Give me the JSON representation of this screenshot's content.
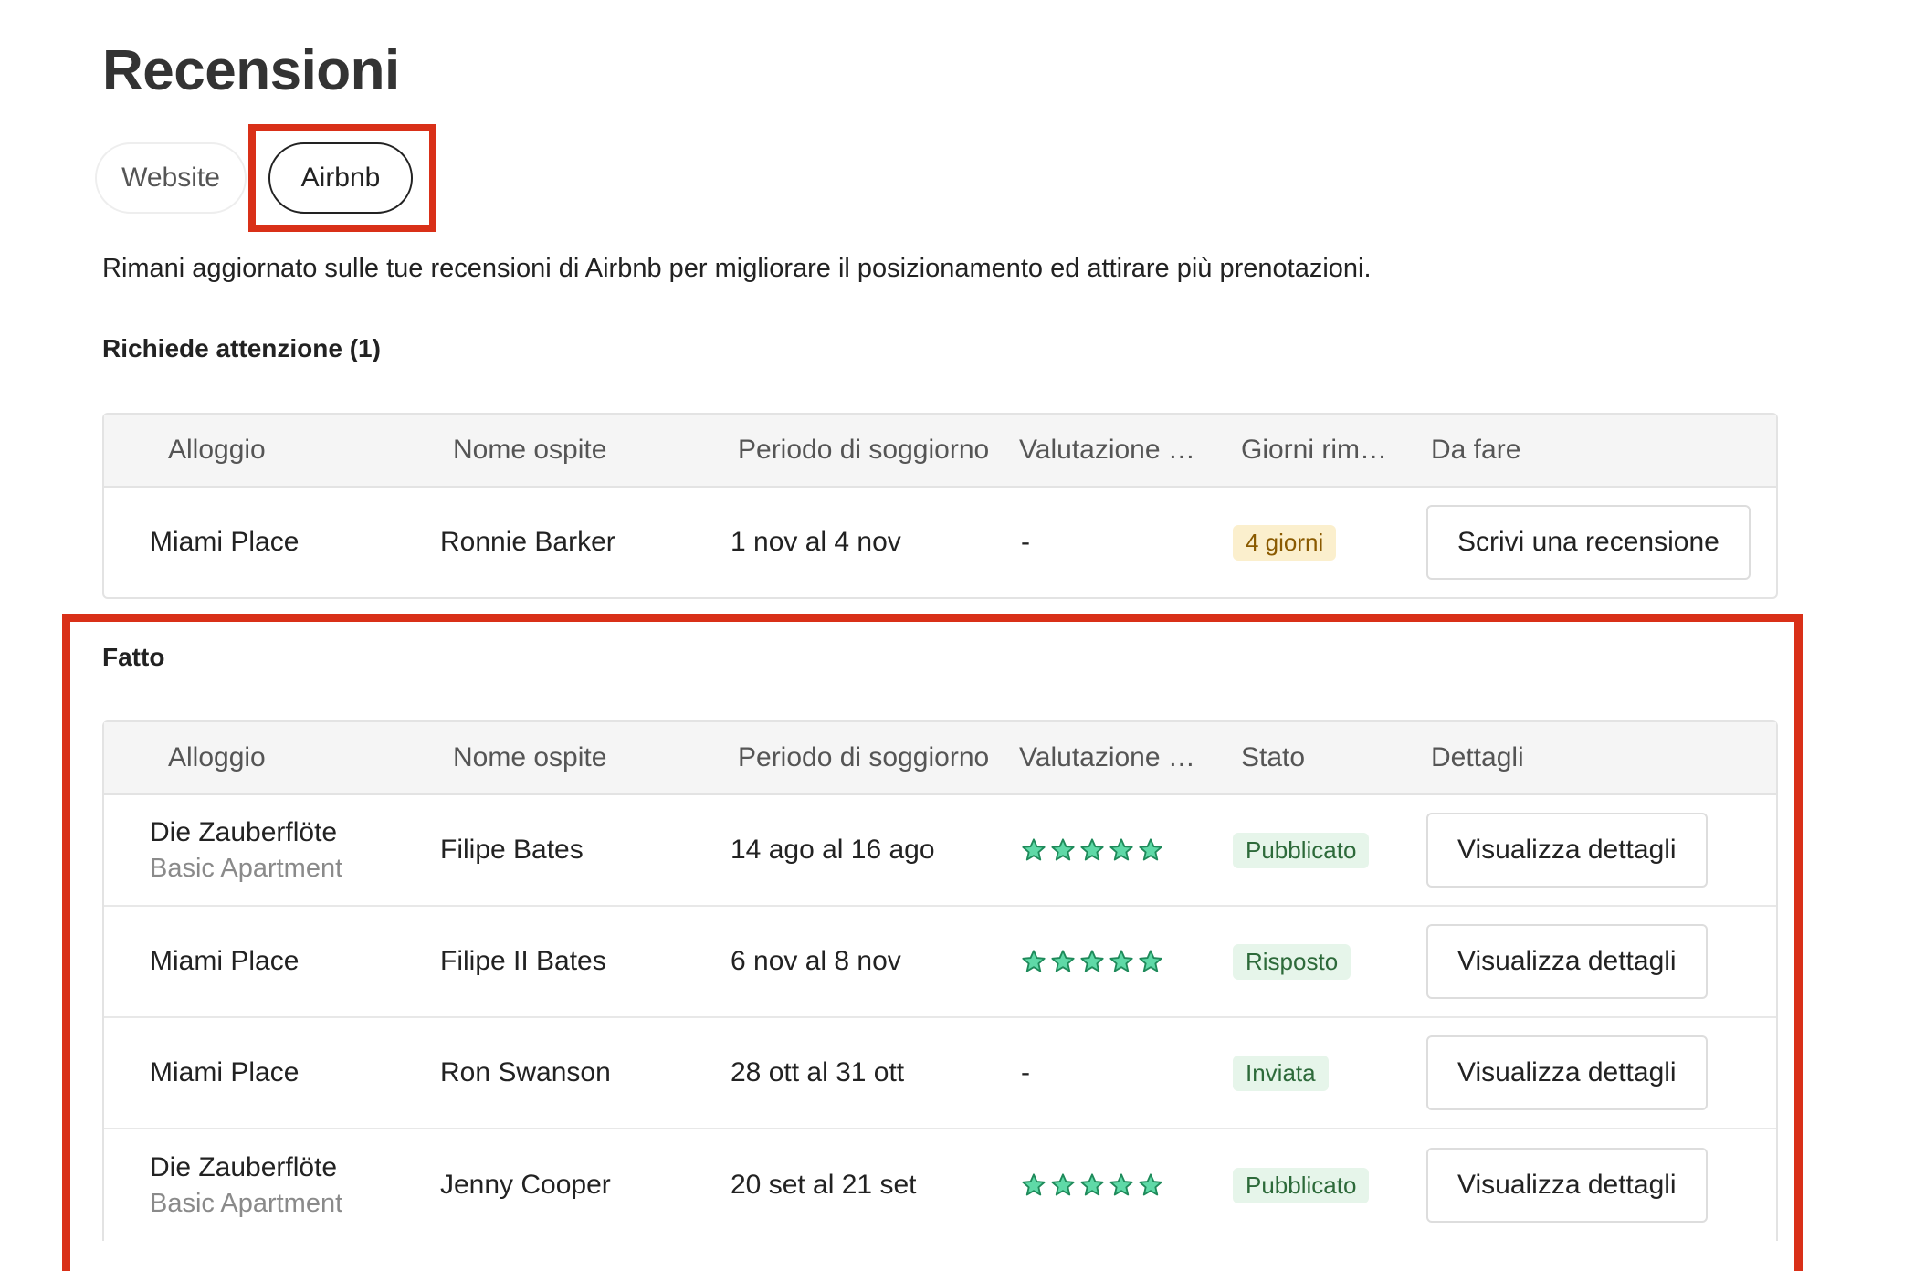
{
  "page": {
    "title": "Recensioni",
    "intro": "Rimani aggiornato sulle tue recensioni di Airbnb per migliorare il posizionamento ed attirare più prenotazioni."
  },
  "tabs": [
    {
      "label": "Website",
      "active": false
    },
    {
      "label": "Airbnb",
      "active": true
    }
  ],
  "attention": {
    "title": "Richiede attenzione (1)",
    "columns": [
      "Alloggio",
      "Nome ospite",
      "Periodo di soggiorno",
      "Valutazione …",
      "Giorni rim…",
      "Da fare"
    ],
    "rows": [
      {
        "property": "Miami Place",
        "guest": "Ronnie Barker",
        "period": "1 nov al 4 nov",
        "rating": "-",
        "days_left": "4 giorni",
        "action": "Scrivi una recensione"
      }
    ]
  },
  "done": {
    "title": "Fatto",
    "columns": [
      "Alloggio",
      "Nome ospite",
      "Periodo di soggiorno",
      "Valutazione …",
      "Stato",
      "Dettagli"
    ],
    "rows": [
      {
        "property": "Die Zauberflöte",
        "unit": "Basic Apartment",
        "guest": "Filipe Bates",
        "period": "14 ago al 16 ago",
        "rating": 5,
        "rating_text": "",
        "status": "Pubblicato",
        "action": "Visualizza dettagli"
      },
      {
        "property": "Miami Place",
        "unit": "",
        "guest": "Filipe II Bates",
        "period": "6 nov al 8 nov",
        "rating": 5,
        "rating_text": "",
        "status": "Risposto",
        "action": "Visualizza dettagli"
      },
      {
        "property": "Miami Place",
        "unit": "",
        "guest": "Ron Swanson",
        "period": "28 ott al 31 ott",
        "rating": 0,
        "rating_text": "-",
        "status": "Inviata",
        "action": "Visualizza dettagli"
      },
      {
        "property": "Die Zauberflöte",
        "unit": "Basic Apartment",
        "guest": "Jenny Cooper",
        "period": "20 set al 21 set",
        "rating": 5,
        "rating_text": "",
        "status": "Pubblicato",
        "action": "Visualizza dettagli"
      }
    ]
  },
  "colors": {
    "highlight": "#d93018",
    "star_fill": "#5fd9a7",
    "star_stroke": "#1e8a5a"
  }
}
